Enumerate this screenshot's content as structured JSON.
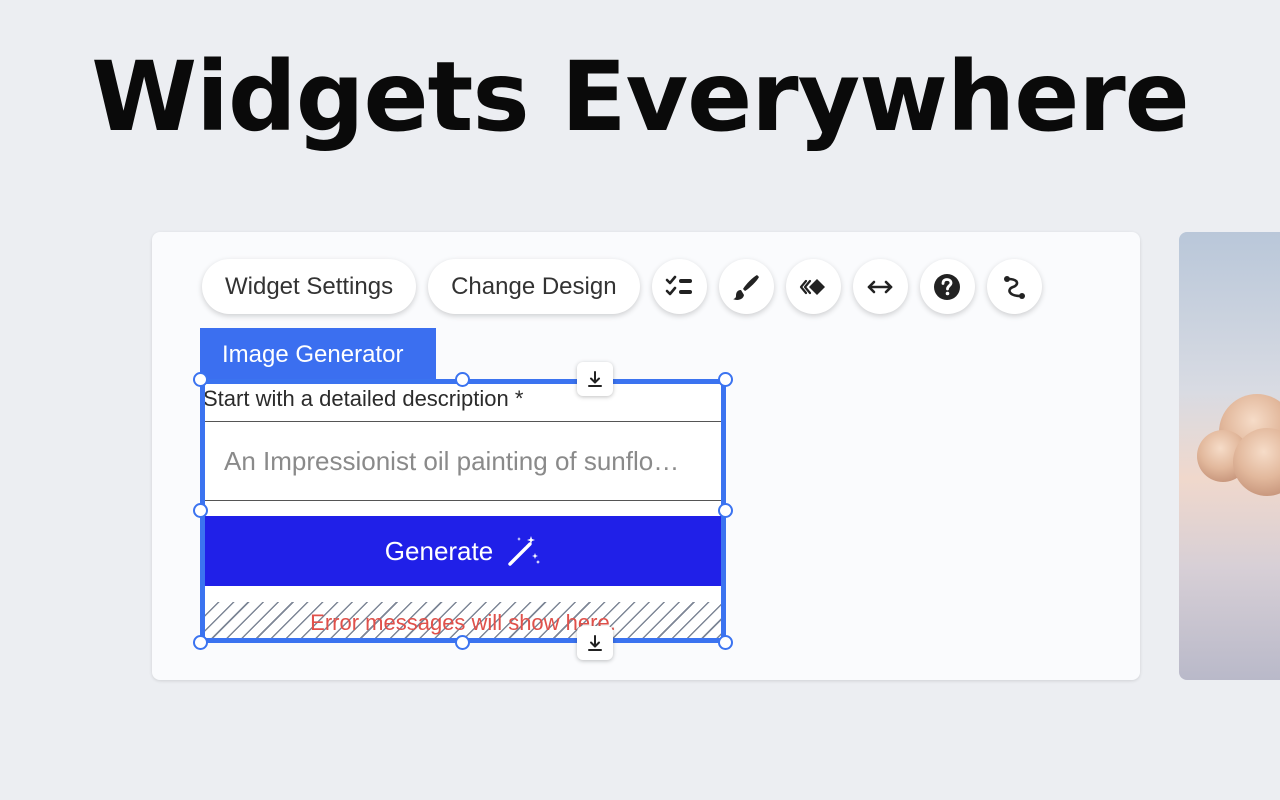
{
  "headline": "Widgets Everywhere",
  "toolbar": {
    "widget_settings_label": "Widget Settings",
    "change_design_label": "Change Design",
    "icons": [
      "checklist-icon",
      "brush-icon",
      "animation-icon",
      "stretch-icon",
      "help-icon",
      "connect-icon"
    ]
  },
  "widget": {
    "tab_label": "Image Generator",
    "description_label": "Start with a detailed description *",
    "prompt_placeholder": "An Impressionist oil painting of sunflo…",
    "generate_label": "Generate",
    "error_text": "Error messages will show here."
  },
  "colors": {
    "accent": "#3b73f0",
    "generate_button": "#2020e8",
    "error": "#e0514b",
    "background": "#eceef2"
  }
}
